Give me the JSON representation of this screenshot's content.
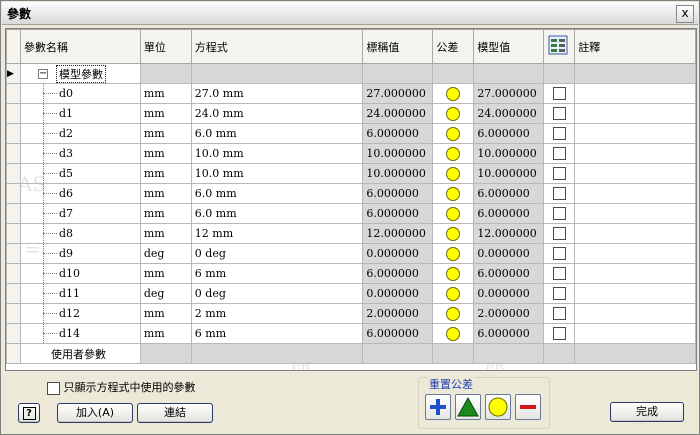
{
  "window": {
    "title": "參數",
    "close_glyph": "x"
  },
  "columns": {
    "name": "參數名稱",
    "unit": "單位",
    "equation": "方程式",
    "nominal": "標稱值",
    "tolerance": "公差",
    "model": "模型值",
    "comment": "註釋"
  },
  "model_group": {
    "label": "模型參數",
    "expander": "−"
  },
  "rows": [
    {
      "name": "d0",
      "unit": "mm",
      "equation": "27.0 mm",
      "nominal": "27.000000",
      "model": "27.000000"
    },
    {
      "name": "d1",
      "unit": "mm",
      "equation": "24.0 mm",
      "nominal": "24.000000",
      "model": "24.000000"
    },
    {
      "name": "d2",
      "unit": "mm",
      "equation": "6.0 mm",
      "nominal": "6.000000",
      "model": "6.000000"
    },
    {
      "name": "d3",
      "unit": "mm",
      "equation": "10.0 mm",
      "nominal": "10.000000",
      "model": "10.000000"
    },
    {
      "name": "d5",
      "unit": "mm",
      "equation": "10.0 mm",
      "nominal": "10.000000",
      "model": "10.000000"
    },
    {
      "name": "d6",
      "unit": "mm",
      "equation": "6.0 mm",
      "nominal": "6.000000",
      "model": "6.000000"
    },
    {
      "name": "d7",
      "unit": "mm",
      "equation": "6.0 mm",
      "nominal": "6.000000",
      "model": "6.000000"
    },
    {
      "name": "d8",
      "unit": "mm",
      "equation": "12 mm",
      "nominal": "12.000000",
      "model": "12.000000"
    },
    {
      "name": "d9",
      "unit": "deg",
      "equation": "0 deg",
      "nominal": "0.000000",
      "model": "0.000000"
    },
    {
      "name": "d10",
      "unit": "mm",
      "equation": "6 mm",
      "nominal": "6.000000",
      "model": "6.000000"
    },
    {
      "name": "d11",
      "unit": "deg",
      "equation": "0 deg",
      "nominal": "0.000000",
      "model": "0.000000"
    },
    {
      "name": "d12",
      "unit": "mm",
      "equation": "2 mm",
      "nominal": "2.000000",
      "model": "2.000000"
    },
    {
      "name": "d14",
      "unit": "mm",
      "equation": "6 mm",
      "nominal": "6.000000",
      "model": "6.000000"
    }
  ],
  "user_group": {
    "label": "使用者參數"
  },
  "watermark": {
    "t1": "AS",
    "t2": "=",
    "t3": "eR",
    "t4": "eR"
  },
  "bottom": {
    "checkbox_label": "只顯示方程式中使用的參數",
    "help_glyph": "?",
    "add_label": "加入(A)",
    "link_label": "連結",
    "reset_tolerance_label": "重置公差",
    "done_label": "完成"
  },
  "colors": {
    "tolerance_circle": "#ffff00",
    "plus": "#1f4fd0",
    "triangle": "#1a8a1a",
    "minus": "#d01818"
  }
}
